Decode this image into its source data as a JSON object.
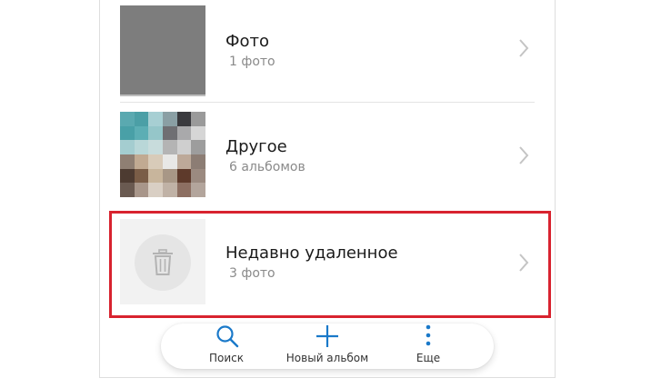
{
  "albums": [
    {
      "title": "Фото",
      "subtitle": "1 фото",
      "thumb": "gray-photo"
    },
    {
      "title": "Другое",
      "subtitle": "6 альбомов",
      "thumb": "pixel-mosaic"
    },
    {
      "title": "Недавно удаленное",
      "subtitle": "3 фото",
      "thumb": "trash-icon"
    }
  ],
  "bottom_bar": {
    "search_label": "Поиск",
    "new_album_label": "Новый альбом",
    "more_label": "Еще"
  },
  "colors": {
    "accent": "#1a79c9",
    "highlight": "#d8232f",
    "thumb_gray": "#7d7d7d"
  }
}
